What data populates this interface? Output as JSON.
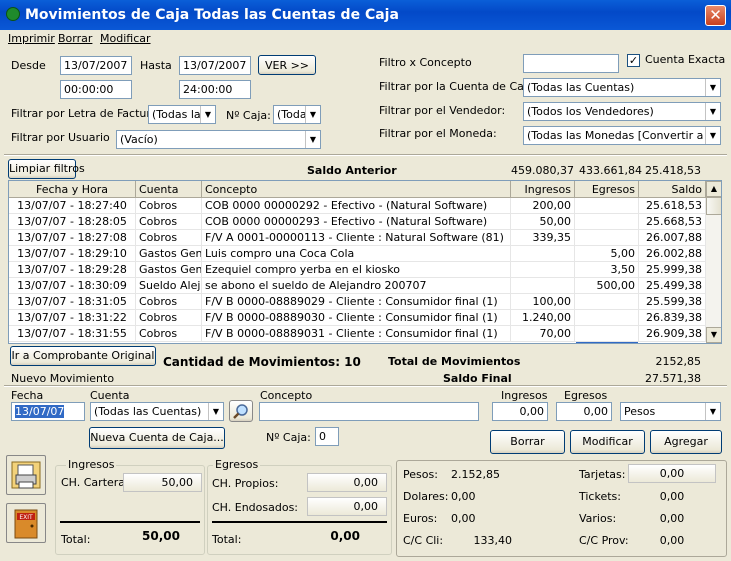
{
  "window": {
    "title": "Movimientos de Caja Todas las Cuentas de Caja",
    "close": "✕"
  },
  "menu": [
    "Imprimir",
    "Borrar",
    "Modificar"
  ],
  "filters": {
    "desde_label": "Desde",
    "desde_date": "13/07/2007",
    "desde_time": "00:00:00",
    "hasta_label": "Hasta",
    "hasta_date": "13/07/2007",
    "hasta_time": "24:00:00",
    "ver_button": "VER >>",
    "letra_label": "Filtrar por Letra de Factura:",
    "letra_value": "(Todas las",
    "caja_label": "Nº Caja:",
    "caja_value": "(Toda",
    "usuario_label": "Filtrar por Usuario",
    "usuario_value": "(Vacío)",
    "concepto_label": "Filtro x Concepto",
    "concepto_value": "",
    "cuenta_exacta_label": "Cuenta Exacta",
    "cuenta_exacta_checked": "✓",
    "cuenta_caja_label": "Filtrar por la Cuenta de Caja:",
    "cuenta_caja_value": "(Todas las Cuentas)",
    "vendedor_label": "Filtrar por el Vendedor:",
    "vendedor_value": "(Todos los Vendedores)",
    "moneda_label": "Filtrar por el Moneda:",
    "moneda_value": "(Todas las Monedas [Convertir a Pes"
  },
  "limpiar_button": "Limpiar filtros",
  "saldo_anterior": {
    "label": "Saldo Anterior",
    "v1": "459.080,37",
    "v2": "433.661,84",
    "v3": "25.418,53"
  },
  "grid": {
    "headers": [
      "Fecha y Hora",
      "Cuenta",
      "Concepto",
      "Ingresos",
      "Egresos",
      "Saldo"
    ],
    "rows": [
      [
        "13/07/07 - 18:27:40",
        "Cobros",
        "COB  0000 00000292 - Efectivo - (Natural Software)",
        "200,00",
        "",
        "25.618,53"
      ],
      [
        "13/07/07 - 18:28:05",
        "Cobros",
        "COB  0000 00000293 - Efectivo - (Natural Software)",
        "50,00",
        "",
        "25.668,53"
      ],
      [
        "13/07/07 - 18:27:08",
        "Cobros",
        "F/V A 0001-00000113 - Cliente : Natural Software (81)",
        "339,35",
        "",
        "26.007,88"
      ],
      [
        "13/07/07 - 18:29:10",
        "Gastos Gene",
        "Luis compro una Coca Cola",
        "",
        "5,00",
        "26.002,88"
      ],
      [
        "13/07/07 - 18:29:28",
        "Gastos Gene",
        "Ezequiel compro yerba en el kiosko",
        "",
        "3,50",
        "25.999,38"
      ],
      [
        "13/07/07 - 18:30:09",
        "Sueldo Alejar",
        "se abono el sueldo de Alejandro 200707",
        "",
        "500,00",
        "25.499,38"
      ],
      [
        "13/07/07 - 18:31:05",
        "Cobros",
        "F/V B 0000-08889029 - Cliente : Consumidor final (1)",
        "100,00",
        "",
        "25.599,38"
      ],
      [
        "13/07/07 - 18:31:22",
        "Cobros",
        "F/V B 0000-08889030 - Cliente : Consumidor final (1)",
        "1.240,00",
        "",
        "26.839,38"
      ],
      [
        "13/07/07 - 18:31:55",
        "Cobros",
        "F/V B 0000-08889031 - Cliente : Consumidor final (1)",
        "70,00",
        "",
        "26.909,38"
      ]
    ]
  },
  "ir_comprobante_button": "Ir a Comprobante Original",
  "cantidad_label": "Cantidad de Movimientos: 10",
  "total_movimientos": {
    "label": "Total de Movimientos",
    "value": "2152,85"
  },
  "saldo_final": {
    "label": "Saldo Final",
    "value": "27.571,38"
  },
  "nuevo": {
    "title": "Nuevo Movimiento",
    "fecha_label": "Fecha",
    "fecha_value": "13/07/07",
    "cuenta_label": "Cuenta",
    "cuenta_value": "(Todas las Cuentas)",
    "concepto_label": "Concepto",
    "concepto_value": "",
    "ingresos_label": "Ingresos",
    "ingresos_value": "0,00",
    "egresos_label": "Egresos",
    "egresos_value": "0,00",
    "moneda_value": "Pesos",
    "nueva_cuenta_button": "Nueva Cuenta de Caja...",
    "caja_label": "Nº Caja:",
    "caja_value": "0",
    "borrar_button": "Borrar",
    "modificar_button": "Modificar",
    "agregar_button": "Agregar"
  },
  "ingresos_group": {
    "title": "Ingresos",
    "cartera_label": "CH. Cartera:",
    "cartera_value": "50,00",
    "total_label": "Total:",
    "total_value": "50,00"
  },
  "egresos_group": {
    "title": "Egresos",
    "propios_label": "CH. Propios:",
    "propios_value": "0,00",
    "endosados_label": "CH. Endosados:",
    "endosados_value": "0,00",
    "total_label": "Total:",
    "total_value": "0,00"
  },
  "summary": {
    "pesos_label": "Pesos:",
    "pesos_value": "2.152,85",
    "dolares_label": "Dolares:",
    "dolares_value": "0,00",
    "euros_label": "Euros:",
    "euros_value": "0,00",
    "cc_cli_label": "C/C Cli:",
    "cc_cli_value": "133,40",
    "tarjetas_label": "Tarjetas:",
    "tarjetas_value": "0,00",
    "tickets_label": "Tickets:",
    "tickets_value": "0,00",
    "varios_label": "Varios:",
    "varios_value": "0,00",
    "cc_prov_label": "C/C Prov:",
    "cc_prov_value": "0,00"
  },
  "exit_icon_text": "EXIT"
}
